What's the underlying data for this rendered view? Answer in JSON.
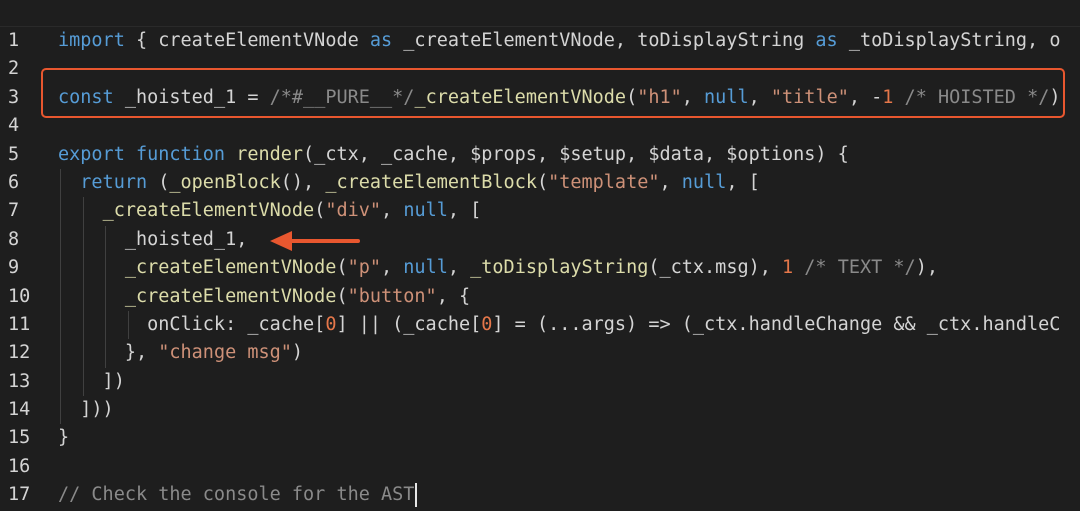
{
  "editor": {
    "lines": [
      {
        "n": "1",
        "tokens": [
          {
            "c": "kw",
            "t": "import"
          },
          {
            "c": "id",
            "t": " { "
          },
          {
            "c": "id",
            "t": "createElementVNode"
          },
          {
            "c": "kw",
            "t": " as "
          },
          {
            "c": "id",
            "t": "_createElementVNode, "
          },
          {
            "c": "id",
            "t": "toDisplayString"
          },
          {
            "c": "kw",
            "t": " as "
          },
          {
            "c": "id",
            "t": "_toDisplayString, o"
          }
        ]
      },
      {
        "n": "2",
        "tokens": []
      },
      {
        "n": "3",
        "tokens": [
          {
            "c": "kw",
            "t": "const"
          },
          {
            "c": "id",
            "t": " _hoisted_1 = "
          },
          {
            "c": "cmt",
            "t": "/*#__PURE__*/"
          },
          {
            "c": "fn",
            "t": "_createElementVNode"
          },
          {
            "c": "id",
            "t": "("
          },
          {
            "c": "str",
            "t": "\"h1\""
          },
          {
            "c": "id",
            "t": ", "
          },
          {
            "c": "kw",
            "t": "null"
          },
          {
            "c": "id",
            "t": ", "
          },
          {
            "c": "str",
            "t": "\"title\""
          },
          {
            "c": "id",
            "t": ", -"
          },
          {
            "c": "num",
            "t": "1"
          },
          {
            "c": "cmt",
            "t": " /* HOISTED */"
          },
          {
            "c": "id",
            "t": ")"
          }
        ]
      },
      {
        "n": "4",
        "tokens": []
      },
      {
        "n": "5",
        "tokens": [
          {
            "c": "kw",
            "t": "export"
          },
          {
            "c": "id",
            "t": " "
          },
          {
            "c": "kw",
            "t": "function"
          },
          {
            "c": "id",
            "t": " "
          },
          {
            "c": "fn",
            "t": "render"
          },
          {
            "c": "id",
            "t": "(_ctx, _cache, $props, $setup, $data, $options) {"
          }
        ]
      },
      {
        "n": "6",
        "guides": [
          1
        ],
        "tokens": [
          {
            "c": "id",
            "t": "  "
          },
          {
            "c": "kw",
            "t": "return"
          },
          {
            "c": "id",
            "t": " ("
          },
          {
            "c": "fn",
            "t": "_openBlock"
          },
          {
            "c": "id",
            "t": "(), "
          },
          {
            "c": "fn",
            "t": "_createElementBlock"
          },
          {
            "c": "id",
            "t": "("
          },
          {
            "c": "str",
            "t": "\"template\""
          },
          {
            "c": "id",
            "t": ", "
          },
          {
            "c": "kw",
            "t": "null"
          },
          {
            "c": "id",
            "t": ", ["
          }
        ]
      },
      {
        "n": "7",
        "guides": [
          1,
          2
        ],
        "tokens": [
          {
            "c": "id",
            "t": "    "
          },
          {
            "c": "fn",
            "t": "_createElementVNode"
          },
          {
            "c": "id",
            "t": "("
          },
          {
            "c": "str",
            "t": "\"div\""
          },
          {
            "c": "id",
            "t": ", "
          },
          {
            "c": "kw",
            "t": "null"
          },
          {
            "c": "id",
            "t": ", ["
          }
        ]
      },
      {
        "n": "8",
        "guides": [
          1,
          2,
          3
        ],
        "tokens": [
          {
            "c": "id",
            "t": "      _hoisted_1,"
          }
        ]
      },
      {
        "n": "9",
        "guides": [
          1,
          2,
          3
        ],
        "tokens": [
          {
            "c": "id",
            "t": "      "
          },
          {
            "c": "fn",
            "t": "_createElementVNode"
          },
          {
            "c": "id",
            "t": "("
          },
          {
            "c": "str",
            "t": "\"p\""
          },
          {
            "c": "id",
            "t": ", "
          },
          {
            "c": "kw",
            "t": "null"
          },
          {
            "c": "id",
            "t": ", "
          },
          {
            "c": "fn",
            "t": "_toDisplayString"
          },
          {
            "c": "id",
            "t": "(_ctx.msg), "
          },
          {
            "c": "num",
            "t": "1"
          },
          {
            "c": "cmt",
            "t": " /* TEXT */"
          },
          {
            "c": "id",
            "t": "),"
          }
        ]
      },
      {
        "n": "10",
        "guides": [
          1,
          2,
          3
        ],
        "tokens": [
          {
            "c": "id",
            "t": "      "
          },
          {
            "c": "fn",
            "t": "_createElementVNode"
          },
          {
            "c": "id",
            "t": "("
          },
          {
            "c": "str",
            "t": "\"button\""
          },
          {
            "c": "id",
            "t": ", {"
          }
        ]
      },
      {
        "n": "11",
        "guides": [
          1,
          2,
          3,
          4
        ],
        "tokens": [
          {
            "c": "id",
            "t": "        onClick: _cache["
          },
          {
            "c": "num",
            "t": "0"
          },
          {
            "c": "id",
            "t": "] || (_cache["
          },
          {
            "c": "num",
            "t": "0"
          },
          {
            "c": "id",
            "t": "] = (...args) => (_ctx.handleChange && _ctx.handleC"
          }
        ]
      },
      {
        "n": "12",
        "guides": [
          1,
          2,
          3
        ],
        "tokens": [
          {
            "c": "id",
            "t": "      }, "
          },
          {
            "c": "str",
            "t": "\"change msg\""
          },
          {
            "c": "id",
            "t": ")"
          }
        ]
      },
      {
        "n": "13",
        "guides": [
          1,
          2
        ],
        "tokens": [
          {
            "c": "id",
            "t": "    ])"
          }
        ]
      },
      {
        "n": "14",
        "guides": [
          1
        ],
        "tokens": [
          {
            "c": "id",
            "t": "  ]))"
          }
        ]
      },
      {
        "n": "15",
        "tokens": [
          {
            "c": "id",
            "t": "}"
          }
        ]
      },
      {
        "n": "16",
        "tokens": []
      },
      {
        "n": "17",
        "cursor": true,
        "tokens": [
          {
            "c": "cmt",
            "t": "// Check the console for the AST"
          }
        ]
      }
    ]
  },
  "annotations": {
    "box_color": "#e8572f",
    "arrow_color": "#e8572f"
  }
}
